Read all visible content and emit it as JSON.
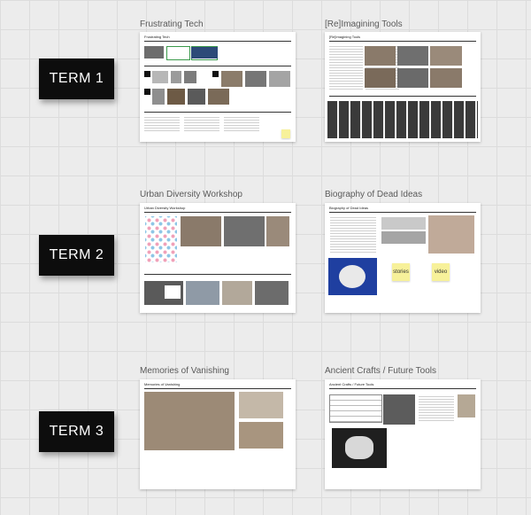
{
  "terms": [
    {
      "label": "TERM 1",
      "cards": [
        {
          "title": "Frustrating Tech",
          "heading": "Frustrating Tech"
        },
        {
          "title": "[Re]Imagining Tools",
          "heading": "[Re]Imagining Tools"
        }
      ]
    },
    {
      "label": "TERM 2",
      "cards": [
        {
          "title": "Urban Diversity Workshop",
          "heading": "Urban Diversity Workshop"
        },
        {
          "title": "Biography of Dead Ideas",
          "heading": "Biography of Dead Ideas",
          "stickies": [
            "stories",
            "video"
          ]
        }
      ]
    },
    {
      "label": "TERM 3",
      "cards": [
        {
          "title": "Memories of Vanishing",
          "heading": "Memories of Vanishing"
        },
        {
          "title": "Ancient Crafts / Future Tools",
          "heading": "Ancient Crafts / Future Tools"
        }
      ]
    }
  ],
  "colors": {
    "label_bg": "#0d0d0d",
    "label_text": "#ffffff",
    "sticky": "#f7f19a",
    "background": "#ececec"
  }
}
